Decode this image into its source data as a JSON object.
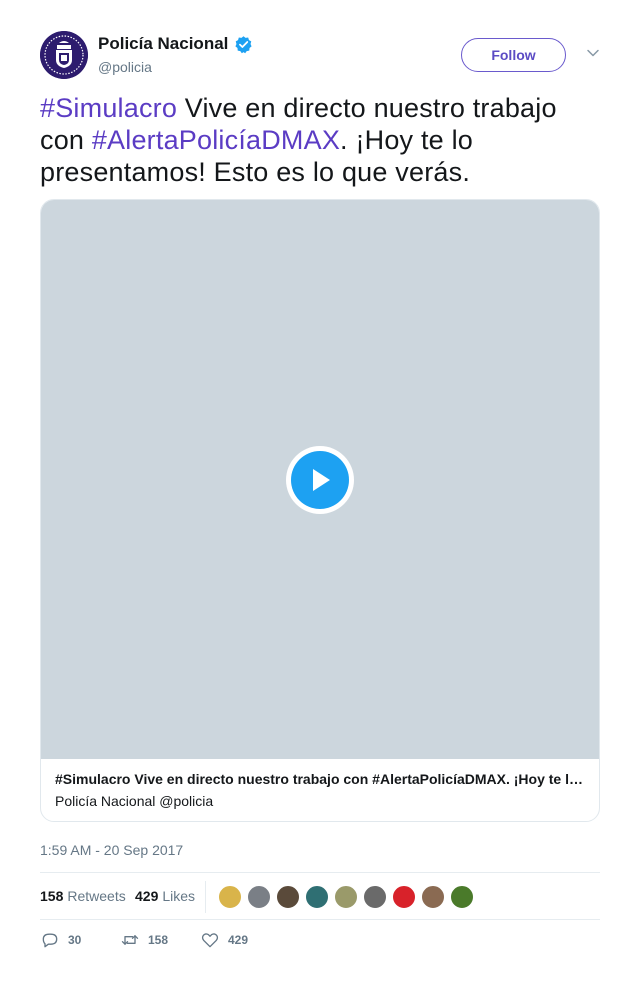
{
  "author": {
    "display_name": "Policía Nacional",
    "handle": "@policia",
    "avatar_icon": "police-crest-icon",
    "verified_icon": "verified-badge-icon"
  },
  "header": {
    "follow_label": "Follow",
    "more_icon": "chevron-down-icon"
  },
  "tweet": {
    "hashtag_1": "#Simulacro",
    "text_1": " Vive en directo nuestro trabajo con ",
    "hashtag_2": "#AlertaPolicíaDMAX",
    "text_2": ". ¡Hoy te lo presentamos! Esto es lo que verás."
  },
  "media": {
    "play_icon": "play-icon",
    "card_title": "#Simulacro Vive en directo nuestro trabajo con #AlertaPolicíaDMAX. ¡Hoy te lo presentamos! Esto es lo que verás.",
    "card_source": "Policía Nacional @policia"
  },
  "timestamp": "1:59 AM - 20 Sep 2017",
  "stats": {
    "retweets_count": "158",
    "retweets_label": "Retweets",
    "likes_count": "429",
    "likes_label": "Likes"
  },
  "likers_colors": [
    "#d9b44a",
    "#7a7f86",
    "#5a4a3a",
    "#2f6f73",
    "#9a9a6a",
    "#6a6a6a",
    "#d8222a",
    "#8a6a52",
    "#4a7a2a"
  ],
  "actions": {
    "reply_count": "30",
    "retweet_count": "158",
    "like_count": "429"
  },
  "colors": {
    "accent": "#5b3cc4",
    "play": "#1da1f2",
    "muted": "#657786"
  }
}
